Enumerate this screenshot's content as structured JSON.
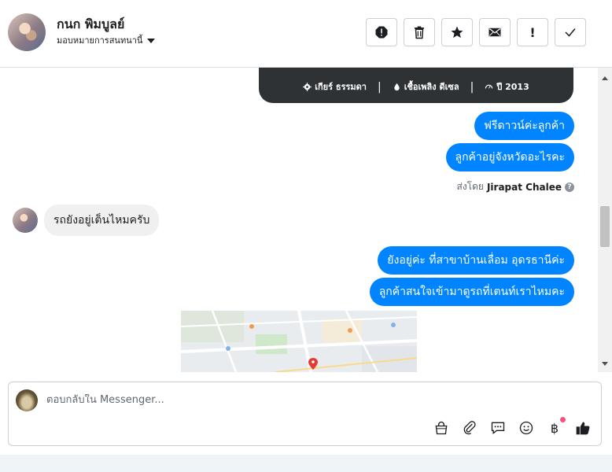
{
  "header": {
    "contact_name": "กนก พิมบูลย์",
    "assign_label": "มอบหมายการสนทนานี้",
    "actions": [
      "spam-report",
      "delete",
      "star",
      "mark-unread",
      "follow-up",
      "done"
    ],
    "follow_up_glyph": "!"
  },
  "thread": {
    "card_specs": {
      "gear": "เกียร์ ธรรมดา",
      "fuel": "เชื้อเพลิง ดีเซล",
      "year": "ปี 2013",
      "separator": "|"
    },
    "outgoing_1": "ฟรีดาวน์ค่ะลูกค้า",
    "outgoing_2": "ลูกค้าอยู่จังหวัดอะไรคะ",
    "sent_by_prefix": "ส่งโดย",
    "sent_by_agent": "Jirapat Chalee",
    "incoming_1": "รถยังอยู่เต็นไหมครับ",
    "outgoing_3": "ยังอยู่ค่ะ ที่สาขาบ้านเลื่อม อุดรธานีค่ะ",
    "outgoing_4": "ลูกค้าสนใจเข้ามาดูรถที่เตนท์เราไหมคะ"
  },
  "composer": {
    "placeholder": "ตอบกลับใน Messenger...",
    "baht_glyph": "฿",
    "tools": [
      "bag-icon",
      "attachment-icon",
      "saved-reply-icon",
      "emoji-icon",
      "baht-icon",
      "like-icon"
    ]
  },
  "colors": {
    "accent_blue": "#0084ff",
    "incoming_bg": "#f1f0f0",
    "card_dark": "#2f3235",
    "notify_dot": "#f5537a"
  }
}
